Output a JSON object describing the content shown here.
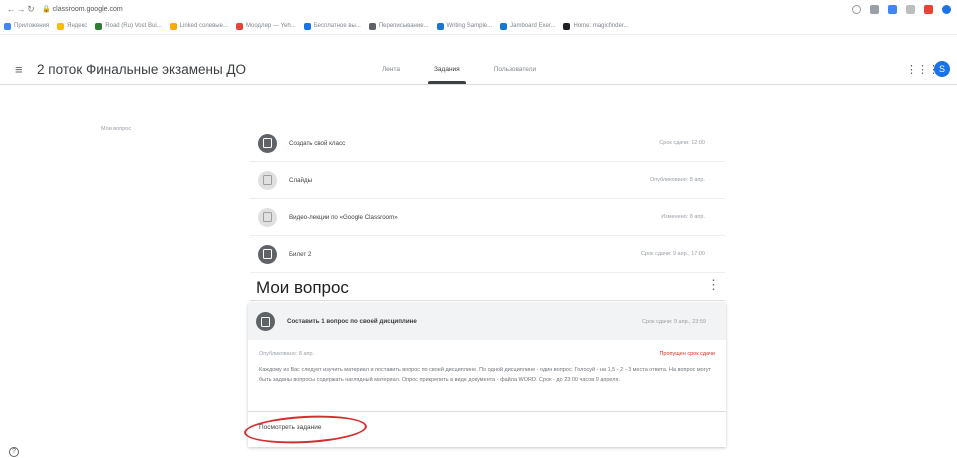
{
  "browser": {
    "url_host": "classroom.google.com",
    "bookmarks": [
      {
        "label": "Приложения",
        "color": "#4285f4"
      },
      {
        "label": "Яндекс",
        "color": "#fbbc04"
      },
      {
        "label": "Road (Ru) Vost Bui...",
        "color": "#2e7d32"
      },
      {
        "label": "Linked солевые...",
        "color": "#f9ab00"
      },
      {
        "label": "Моодлер — Yeh...",
        "color": "#ea4335"
      },
      {
        "label": "Бесплатное вы...",
        "color": "#1a73e8"
      },
      {
        "label": "Переписывание...",
        "color": "#5f6368"
      },
      {
        "label": "Writing Sample...",
        "color": "#1976d2"
      },
      {
        "label": "Jamboard Exer...",
        "color": "#1976d2"
      },
      {
        "label": "Home: magicfinder...",
        "color": "#202124"
      }
    ]
  },
  "header": {
    "title": "2 поток Финальные экзамены ДО",
    "tabs": [
      "Лента",
      "Задания",
      "Пользователи"
    ],
    "avatar_letter": "S"
  },
  "sidebar": {
    "link": "Мои вопрос"
  },
  "assignments": [
    {
      "title": "Создать свой класс",
      "meta": "Срок сдачи: 12:00",
      "icon": "assignment"
    },
    {
      "title": "Слайды",
      "meta": "Опубликовано: 8 апр.",
      "icon": "material"
    },
    {
      "title": "Видео-лекции по «Google Classroom»",
      "meta": "Изменено: 8 апр.",
      "icon": "material"
    },
    {
      "title": "Билет 2",
      "meta": "Срок сдачи: 9 апр., 17:00",
      "icon": "assignment"
    }
  ],
  "section": {
    "title": "Мои вопрос",
    "card": {
      "title": "Составить 1 вопрос по своей дисциплине",
      "meta": "Срок сдачи: 9 апр., 23:59",
      "posted": "Опубликовано: 8 апр.",
      "status": "Пропущен срок сдачи",
      "description": "Каждому из Вас следует изучить материал и поставить вопрос по своей дисциплине. По одной дисциплине - один вопрос. Голосуй - на 1,5 - 2 - 3 места ответа. На вопрос могут быть заданы вопросы содержать наглядный материал. Опрос прикрепить в виде документа - файла WORD. Срок - до 23:00 часов 9 апреля.",
      "link": "Посмотреть задание"
    }
  }
}
